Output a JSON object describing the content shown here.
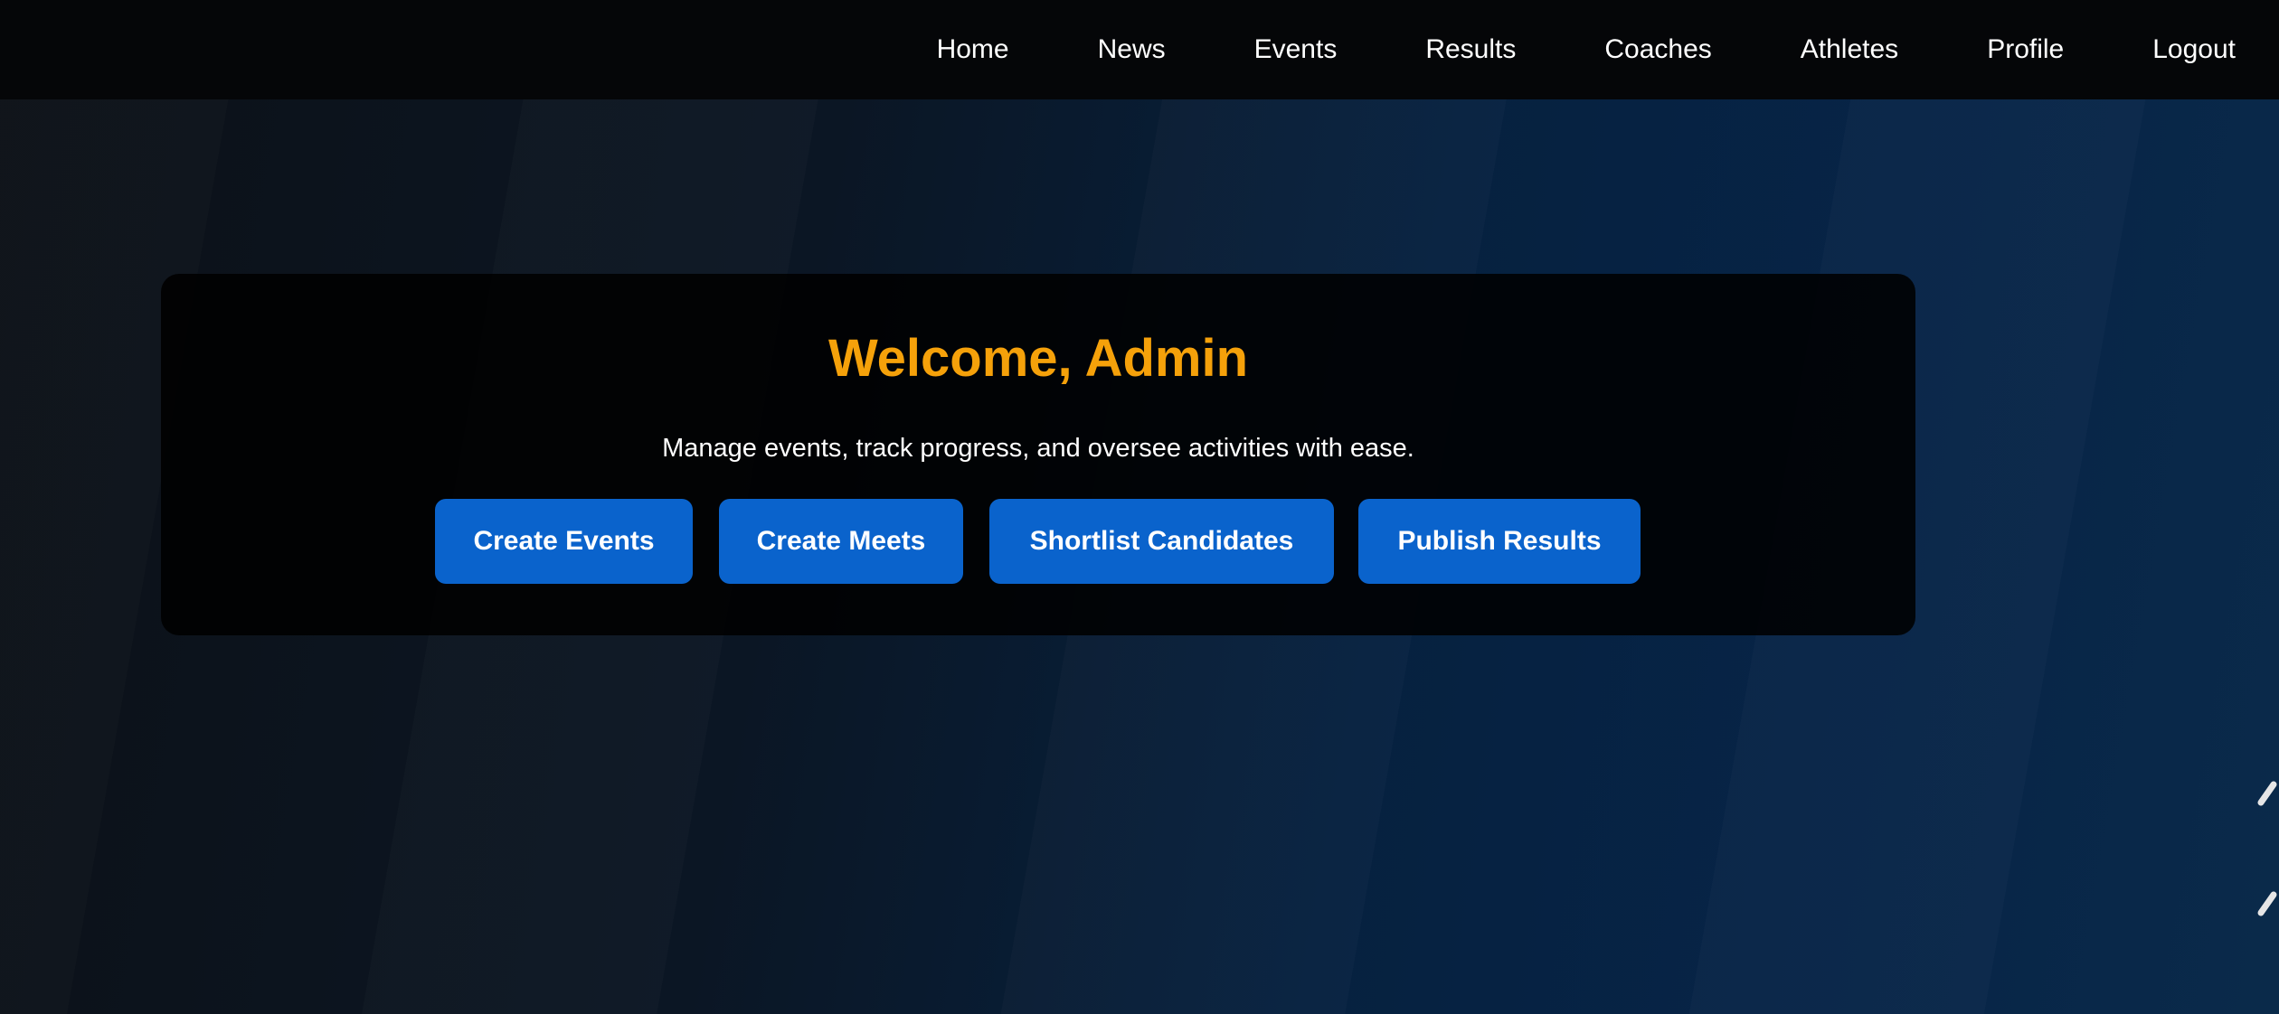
{
  "nav": {
    "items": [
      {
        "label": "Home"
      },
      {
        "label": "News"
      },
      {
        "label": "Events"
      },
      {
        "label": "Results"
      },
      {
        "label": "Coaches"
      },
      {
        "label": "Athletes"
      },
      {
        "label": "Profile"
      },
      {
        "label": "Logout"
      }
    ]
  },
  "hero": {
    "title": "Welcome, Admin",
    "subtitle": "Manage events, track progress, and oversee activities with ease.",
    "buttons": [
      {
        "label": "Create Events"
      },
      {
        "label": "Create Meets"
      },
      {
        "label": "Shortlist Candidates"
      },
      {
        "label": "Publish Results"
      }
    ]
  },
  "colors": {
    "navbar_bg": "#050608",
    "accent_title": "#f5a10a",
    "button_bg": "#0a63cc",
    "card_bg": "#000000"
  }
}
